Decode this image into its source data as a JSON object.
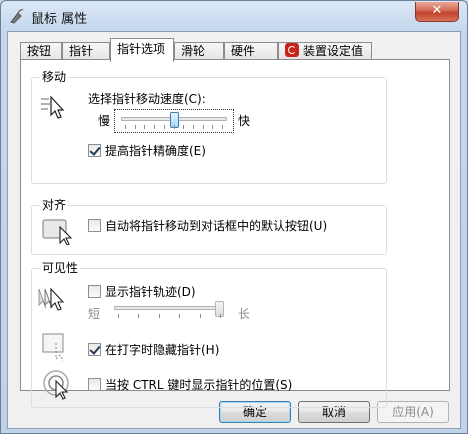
{
  "window": {
    "title": "鼠标 属性",
    "close_label": "✕"
  },
  "tabs": [
    {
      "label": "按钮",
      "active": false
    },
    {
      "label": "指针",
      "active": false
    },
    {
      "label": "指针选项",
      "active": true
    },
    {
      "label": "滑轮",
      "active": false
    },
    {
      "label": "硬件",
      "active": false
    },
    {
      "label": "装置设定值",
      "active": false
    }
  ],
  "motion": {
    "title": "移动",
    "speed_label": "选择指针移动速度(C):",
    "slow_label": "慢",
    "fast_label": "快",
    "speed_level": 0.5,
    "precision_label": "提高指针精确度(E)",
    "precision_checked": true
  },
  "snap_to": {
    "title": "对齐",
    "label": "自动将指针移动到对话框中的默认按钮(U)",
    "checked": false
  },
  "visibility": {
    "title": "可见性",
    "trails_label": "显示指针轨迹(D)",
    "trails_checked": false,
    "short_label": "短",
    "long_label": "长",
    "trails_level": 1.0,
    "hide_label": "在打字时隐藏指针(H)",
    "hide_checked": true,
    "ctrl_label": "当按 CTRL 键时显示指针的位置(S)",
    "ctrl_checked": false
  },
  "buttons": {
    "ok": "确定",
    "cancel": "取消",
    "apply": "应用(A)"
  }
}
